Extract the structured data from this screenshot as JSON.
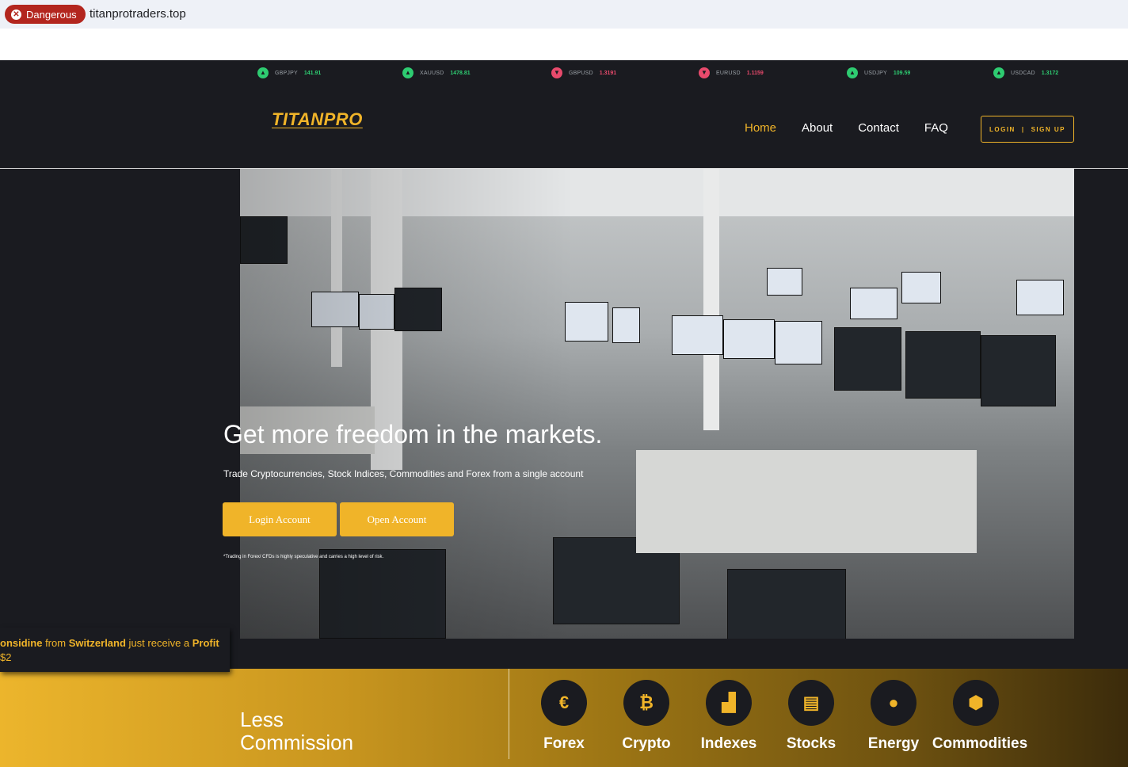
{
  "browser": {
    "security_label": "Dangerous",
    "url": "titanprotraders.top"
  },
  "ticker": [
    {
      "symbol": "GBPJPY",
      "value": "141.91",
      "direction": "up"
    },
    {
      "symbol": "XAUUSD",
      "value": "1478.81",
      "direction": "up"
    },
    {
      "symbol": "GBPUSD",
      "value": "1.3191",
      "direction": "down"
    },
    {
      "symbol": "EURUSD",
      "value": "1.1159",
      "direction": "down"
    },
    {
      "symbol": "USDJPY",
      "value": "109.59",
      "direction": "up"
    },
    {
      "symbol": "USDCAD",
      "value": "1.3172",
      "direction": "up"
    }
  ],
  "header": {
    "logo": "TITANPRO",
    "nav": [
      {
        "label": "Home",
        "active": true
      },
      {
        "label": "About",
        "active": false
      },
      {
        "label": "Contact",
        "active": false
      },
      {
        "label": "FAQ",
        "active": false
      }
    ],
    "login_label": "LOGIN",
    "divider": "|",
    "signup_label": "SIGN UP"
  },
  "hero": {
    "title_before": "Get more ",
    "title_highlight": "freedom",
    "title_after": " in the markets.",
    "subtitle": "Trade Cryptocurrencies, Stock Indices, Commodities and Forex from a single account",
    "login_button": "Login Account",
    "open_button": "Open Account",
    "disclaimer": "*Trading in Forex/ CFDs is highly speculative and carries a high level of risk."
  },
  "toast": {
    "name": "onsidine",
    "from_text": " from ",
    "country": "Switzerland",
    "middle_text": " just receive a ",
    "profit_word": "Profit",
    "line2": "$2"
  },
  "band": {
    "title_line1": "Less",
    "title_line2": "Commission",
    "categories": [
      {
        "label": "Forex",
        "icon": "euro-icon",
        "glyph": "€"
      },
      {
        "label": "Crypto",
        "icon": "bitcoin-icon",
        "glyph": "₿"
      },
      {
        "label": "Indexes",
        "icon": "area-chart-icon",
        "glyph": "▟"
      },
      {
        "label": "Stocks",
        "icon": "document-chart-icon",
        "glyph": "▤"
      },
      {
        "label": "Energy",
        "icon": "drop-icon",
        "glyph": "●"
      },
      {
        "label": "Commodities",
        "icon": "box-icon",
        "glyph": "⬢"
      }
    ]
  },
  "colors": {
    "accent": "#f0b429",
    "background": "#1a1b20",
    "up": "#2ecc71",
    "down": "#e84a6c",
    "danger": "#b3261e"
  }
}
